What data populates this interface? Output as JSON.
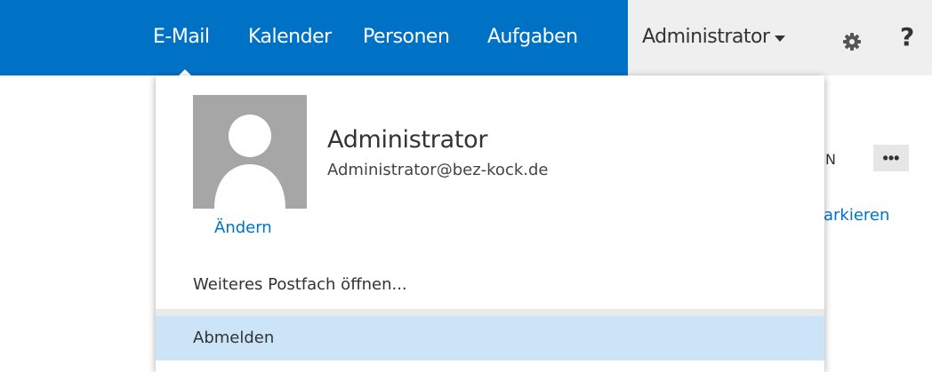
{
  "nav": {
    "items": [
      {
        "label": "E-Mail",
        "active": true
      },
      {
        "label": "Kalender"
      },
      {
        "label": "Personen"
      },
      {
        "label": "Aufgaben"
      }
    ],
    "user_menu_label": "Administrator",
    "settings_icon": "gear-icon",
    "help_label": "?"
  },
  "background": {
    "partial_text": "N",
    "more_label": "•••",
    "partial_link": "arkieren"
  },
  "account_panel": {
    "display_name": "Administrator",
    "email": "Administrator@bez-kock.de",
    "change_photo_label": "Ändern",
    "open_other_mailbox_label": "Weiteres Postfach öffnen...",
    "sign_out_label": "Abmelden"
  },
  "colors": {
    "brand_blue": "#0072c6",
    "hover_highlight": "#cce4f7",
    "avatar_grey": "#a6a6a6"
  }
}
